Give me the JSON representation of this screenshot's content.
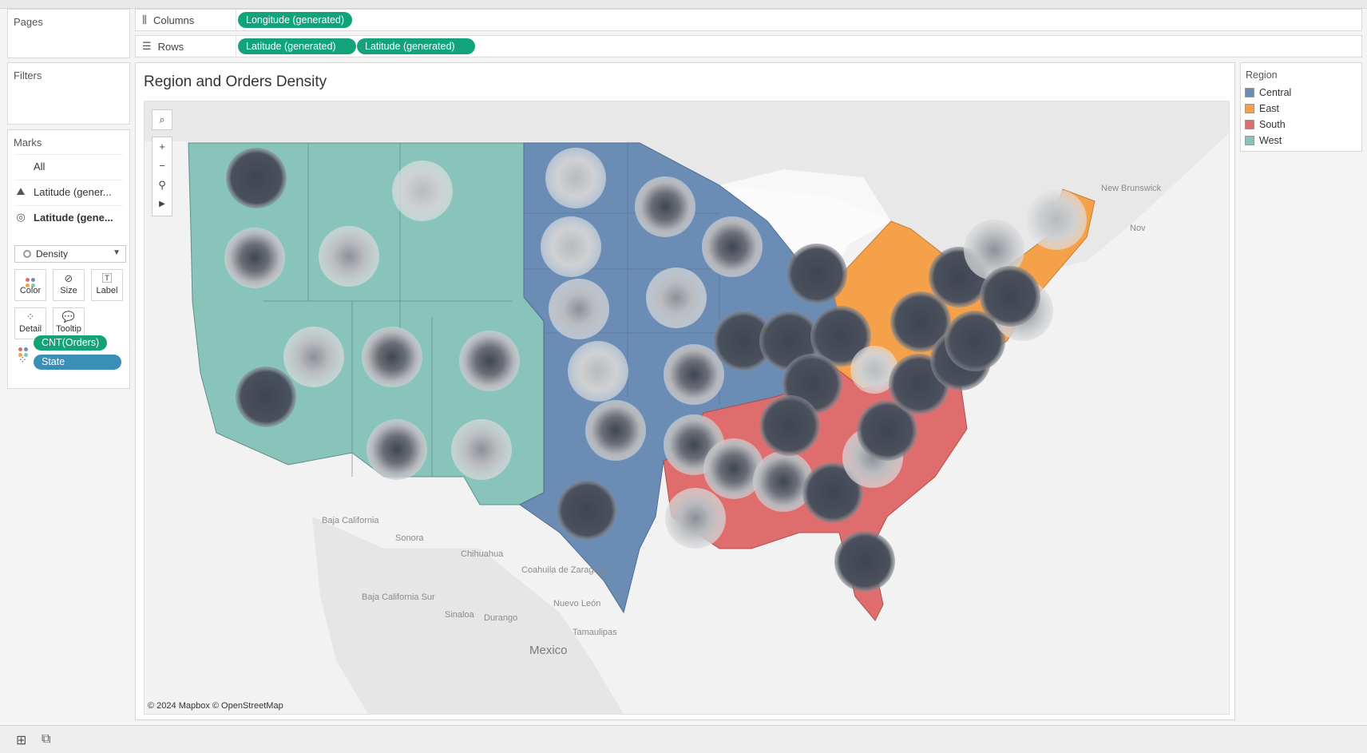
{
  "shelves": {
    "columns_label": "Columns",
    "rows_label": "Rows",
    "columns_pills": [
      "Longitude (generated)"
    ],
    "rows_pills": [
      "Latitude (generated)",
      "Latitude (generated)"
    ]
  },
  "panels": {
    "pages": "Pages",
    "filters": "Filters",
    "marks": "Marks"
  },
  "marks": {
    "all": "All",
    "layer1": "Latitude (gener...",
    "layer2": "Latitude (gene...",
    "mark_type": "Density",
    "buttons": {
      "color": "Color",
      "size": "Size",
      "label": "Label",
      "detail": "Detail",
      "tooltip": "Tooltip"
    },
    "fields": [
      "CNT(Orders)",
      "State"
    ]
  },
  "viz": {
    "title": "Region and Orders Density",
    "attribution": "© 2024 Mapbox © OpenStreetMap"
  },
  "map_labels": [
    "New Brunswick",
    "Nov",
    "Baja California",
    "Sonora",
    "Chihuahua",
    "Coahuila de Zaragoza",
    "Baja California Sur",
    "Sinaloa",
    "Durango",
    "Nuevo León",
    "Tamaulipas",
    "Mexico"
  ],
  "legend": {
    "title": "Region",
    "items": [
      {
        "label": "Central",
        "color": "#6a8cb5"
      },
      {
        "label": "East",
        "color": "#f4a14a"
      },
      {
        "label": "South",
        "color": "#e06d6d"
      },
      {
        "label": "West",
        "color": "#89c4bb"
      }
    ]
  },
  "colors": {
    "pill": "#12a37a",
    "state_pill": "#3a8fb7",
    "density_dark": "#434956"
  }
}
